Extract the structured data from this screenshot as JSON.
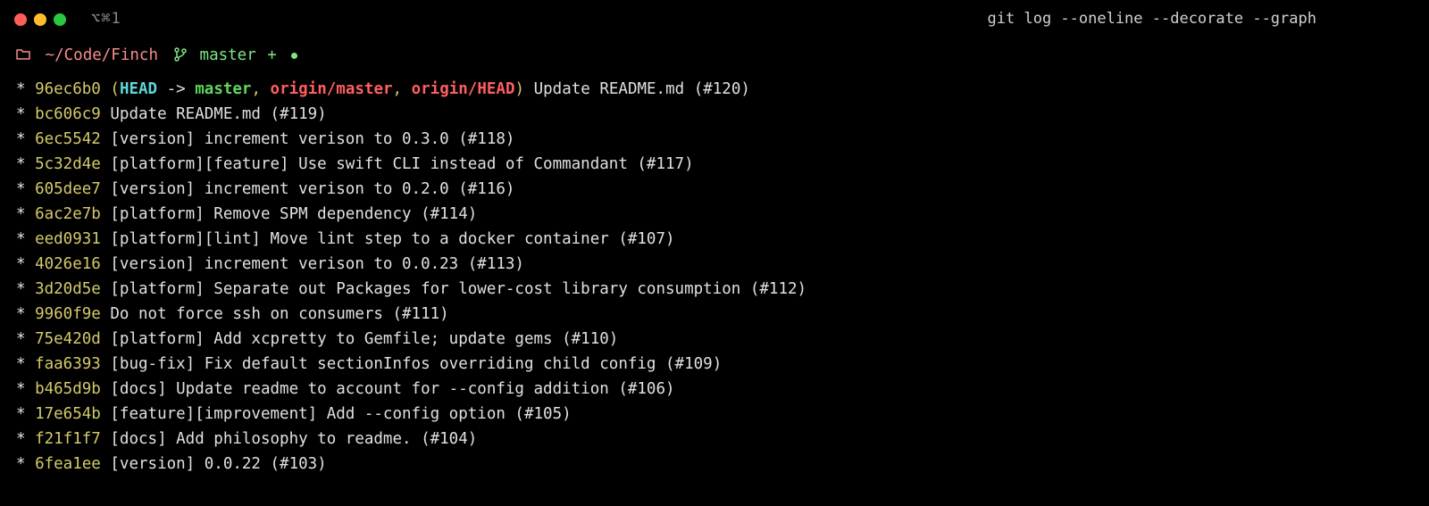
{
  "titlebar": {
    "tab_indicator": "⌥⌘1",
    "command": "git log --oneline --decorate --graph"
  },
  "prompt": {
    "cwd": "~/Code/Finch",
    "branch": "master",
    "branch_suffix": "+"
  },
  "decoration": {
    "open_paren": "(",
    "head": "HEAD",
    "arrow": " -> ",
    "branch": "master",
    "comma": ", ",
    "remote1": "origin/master",
    "remote2": "origin/HEAD",
    "close_paren": ")"
  },
  "commits": [
    {
      "hash": "96ec6b0",
      "message": "Update README.md (#120)",
      "decorated": true
    },
    {
      "hash": "bc606c9",
      "message": "Update README.md (#119)"
    },
    {
      "hash": "6ec5542",
      "message": "[version] increment verison to 0.3.0 (#118)"
    },
    {
      "hash": "5c32d4e",
      "message": "[platform][feature] Use swift CLI instead of Commandant (#117)"
    },
    {
      "hash": "605dee7",
      "message": "[version] increment verison to 0.2.0 (#116)"
    },
    {
      "hash": "6ac2e7b",
      "message": "[platform] Remove SPM dependency (#114)"
    },
    {
      "hash": "eed0931",
      "message": "[platform][lint] Move lint step to a docker container (#107)"
    },
    {
      "hash": "4026e16",
      "message": "[version] increment verison to 0.0.23 (#113)"
    },
    {
      "hash": "3d20d5e",
      "message": "[platform] Separate out Packages for lower-cost library consumption (#112)"
    },
    {
      "hash": "9960f9e",
      "message": "Do not force ssh on consumers (#111)"
    },
    {
      "hash": "75e420d",
      "message": "[platform] Add xcpretty to Gemfile; update gems (#110)"
    },
    {
      "hash": "faa6393",
      "message": "[bug-fix] Fix default sectionInfos overriding child config (#109)"
    },
    {
      "hash": "b465d9b",
      "message": "[docs] Update readme to account for --config addition (#106)"
    },
    {
      "hash": "17e654b",
      "message": "[feature][improvement] Add --config option (#105)"
    },
    {
      "hash": "f21f1f7",
      "message": "[docs] Add philosophy to readme. (#104)"
    },
    {
      "hash": "6fea1ee",
      "message": "[version] 0.0.22 (#103)"
    }
  ]
}
